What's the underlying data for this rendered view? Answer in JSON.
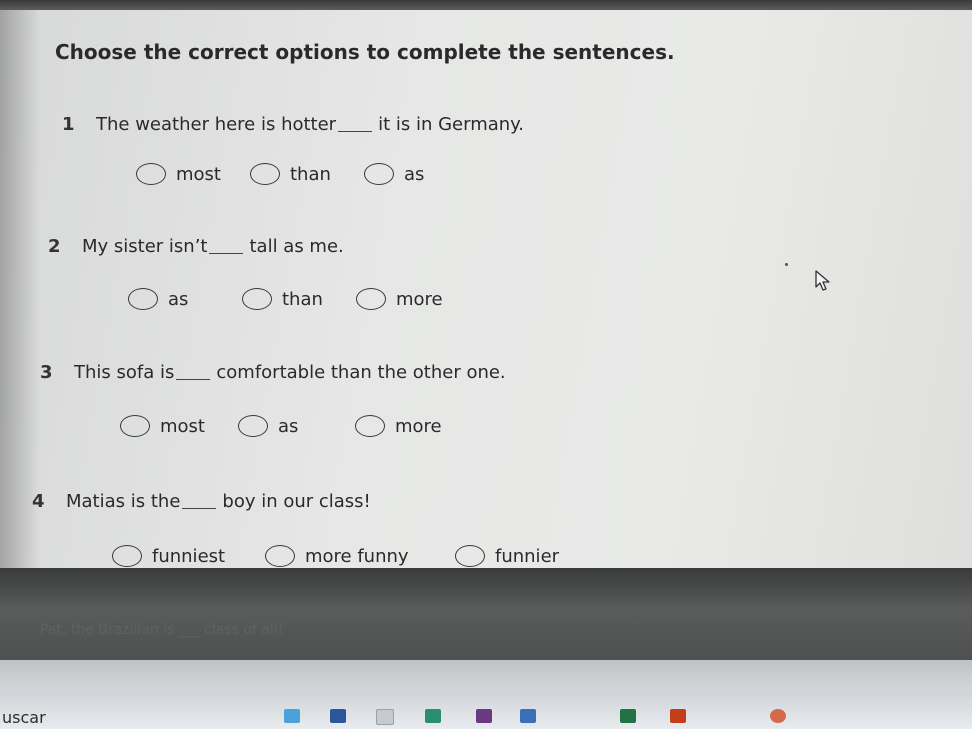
{
  "instruction": "Choose the correct options to complete the sentences.",
  "questions": [
    {
      "number": "1",
      "before": "The weather here is hotter",
      "after": "it is in Germany.",
      "options": [
        "most",
        "than",
        "as"
      ]
    },
    {
      "number": "2",
      "before": "My sister isn’t",
      "after": "tall as me.",
      "options": [
        "as",
        "than",
        "more"
      ]
    },
    {
      "number": "3",
      "before": "This sofa is",
      "after": "comfortable than the other one.",
      "options": [
        "most",
        "as",
        "more"
      ]
    },
    {
      "number": "4",
      "before": "Matias is the",
      "after": "boy in our class!",
      "options": [
        "funniest",
        "more funny",
        "funnier"
      ]
    }
  ],
  "partially_visible_question": "Pat, the Brazilian is ___ class of all!",
  "taskbar": {
    "search_text": "uscar",
    "icons": [
      "chrome-icon",
      "word-icon",
      "link-icon",
      "edge-icon",
      "calendar-icon",
      "store-icon",
      "excel-icon",
      "powerpoint-icon",
      "app-icon"
    ]
  },
  "colors": {
    "page_bg": "#e6e7e6",
    "text": "#2a2a2a",
    "dark_band": "#4d4f50",
    "taskbar": "#dfe2e5"
  }
}
